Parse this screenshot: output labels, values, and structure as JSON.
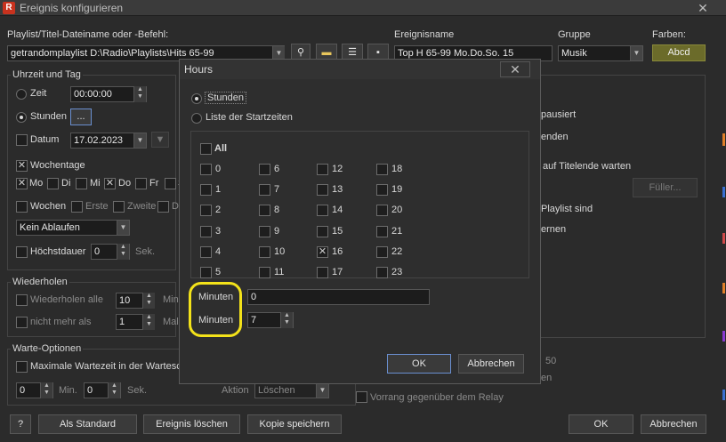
{
  "window": {
    "title": "Ereignis konfigurieren",
    "app_icon": "R"
  },
  "top": {
    "playlist_label": "Playlist/Titel-Dateiname oder -Befehl:",
    "playlist_value": "getrandomplaylist D:\\Radio\\Playlists\\Hits 65-99",
    "event_name_label": "Ereignisname",
    "event_name_value": "Top H 65-99 Mo.Do.So. 15",
    "group_label": "Gruppe",
    "group_value": "Musik",
    "colors_label": "Farben:",
    "color_button": "Abcd",
    "color_button_bg": "#6b6b2a"
  },
  "left": {
    "time_day_section": "Uhrzeit und Tag",
    "zeit_label": "Zeit",
    "zeit_value": "00:00:00",
    "stunden_label": "Stunden",
    "stunden_btn": "...",
    "datum_label": "Datum",
    "datum_value": "17.02.2023",
    "wochentage_label": "Wochentage",
    "days": [
      "Mo",
      "Di",
      "Mi",
      "Do",
      "Fr",
      "S"
    ],
    "wochen_label": "Wochen",
    "erste": "Erste",
    "zweite": "Zweite",
    "d_trunc": "D",
    "ablaufen_value": "Kein Ablaufen",
    "hoechstdauer_label": "Höchstdauer",
    "hoechstdauer_value": "0",
    "sek": "Sek."
  },
  "repeat": {
    "section": "Wiederholen",
    "wiederholen_alle": "Wiederholen alle",
    "alle_value": "10",
    "min_trunc": "Min",
    "nicht_mehr_als": "nicht mehr als",
    "nicht_value": "1",
    "mal_trunc": "Mal"
  },
  "wait": {
    "section": "Warte-Optionen",
    "max_wait": "Maximale Wartezeit in der Wartesc",
    "min_value": "0",
    "min_label": "Min.",
    "sek_value": "0",
    "sek_label": "Sek.",
    "aktion_label": "Aktion",
    "aktion_value": "Löschen"
  },
  "right": {
    "pausiert": "pausiert",
    "enden": "enden",
    "titelende": "auf Titelende warten",
    "fueller_btn": "Füller...",
    "playlist_sind": "Playlist sind",
    "ernen": "ernen",
    "fifty": "50",
    "en": "en",
    "vorrang": "Vorrang gegenüber dem Relay"
  },
  "bottom": {
    "help": "?",
    "als_standard": "Als Standard",
    "loeschen": "Ereignis löschen",
    "kopie": "Kopie speichern",
    "ok": "OK",
    "abbrechen": "Abbrechen"
  },
  "hours_dialog": {
    "title": "Hours",
    "close": "✕",
    "radio_stunden": "Stunden",
    "radio_start": "Liste der Startzeiten",
    "all_label": "All",
    "hours": [
      {
        "h": "0",
        "checked": false
      },
      {
        "h": "1",
        "checked": false
      },
      {
        "h": "2",
        "checked": false
      },
      {
        "h": "3",
        "checked": false
      },
      {
        "h": "4",
        "checked": false
      },
      {
        "h": "5",
        "checked": false
      },
      {
        "h": "6",
        "checked": false
      },
      {
        "h": "7",
        "checked": false
      },
      {
        "h": "8",
        "checked": false
      },
      {
        "h": "9",
        "checked": false
      },
      {
        "h": "10",
        "checked": false
      },
      {
        "h": "11",
        "checked": false
      },
      {
        "h": "12",
        "checked": false
      },
      {
        "h": "13",
        "checked": false
      },
      {
        "h": "14",
        "checked": false
      },
      {
        "h": "15",
        "checked": false
      },
      {
        "h": "16",
        "checked": true
      },
      {
        "h": "17",
        "checked": false
      },
      {
        "h": "18",
        "checked": false
      },
      {
        "h": "19",
        "checked": false
      },
      {
        "h": "20",
        "checked": false
      },
      {
        "h": "21",
        "checked": false
      },
      {
        "h": "22",
        "checked": false
      },
      {
        "h": "23",
        "checked": false
      }
    ],
    "minuten_label_1": "Minuten",
    "minuten_value_1": "0",
    "minuten_label_2": "Minuten",
    "minuten_value_2": "7",
    "ok": "OK",
    "abbrechen": "Abbrechen",
    "highlight_color": "#f3e21a"
  }
}
